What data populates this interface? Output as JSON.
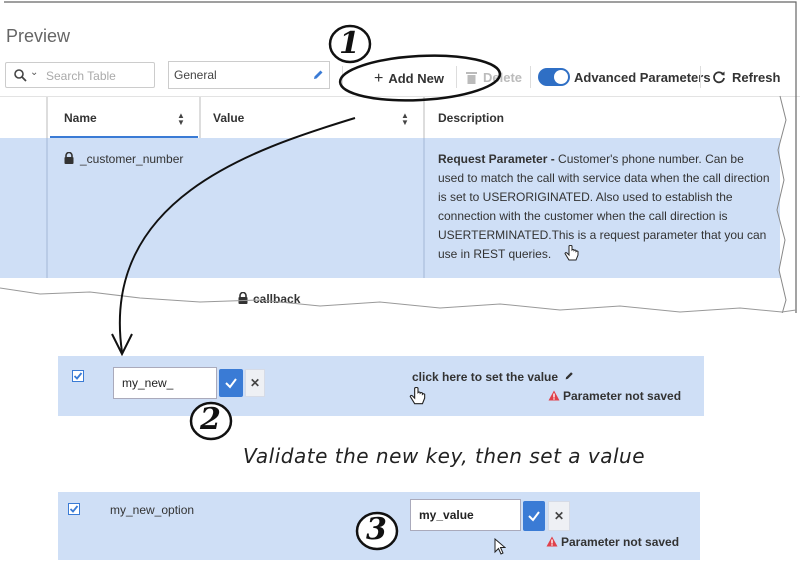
{
  "preview": {
    "title": "Preview",
    "search_placeholder": "Search Table",
    "section_select": "General",
    "toolbar": {
      "add_new": "Add New",
      "delete": "Delete",
      "advanced_parameters": "Advanced Parameters",
      "refresh": "Refresh"
    },
    "columns": [
      "Name",
      "Value",
      "Description"
    ],
    "rows": [
      {
        "name": "_customer_number",
        "description_bold": "Request Parameter -",
        "description": " Customer's phone number. Can be used to match the call with service data when the call direction is set to USERORIGINATED. Also used to establish the connection with the customer when the call direction is USERTERMINATED.This is a request parameter that you can use in REST queries."
      },
      {
        "name": "callback"
      }
    ]
  },
  "step1": {
    "badge": "1"
  },
  "step2": {
    "badge": "2",
    "key_value": "my_new_",
    "value_prompt": "click here to set the value",
    "warning": "Parameter not saved"
  },
  "caption": "Validate the new key, then set a value",
  "step3": {
    "badge": "3",
    "key": "my_new_option",
    "value_input": "my_value",
    "warning": "Parameter not saved"
  },
  "colors": {
    "accent": "#3a7bd5",
    "row_highlight": "#cfdff6",
    "warning": "#e0404a"
  }
}
